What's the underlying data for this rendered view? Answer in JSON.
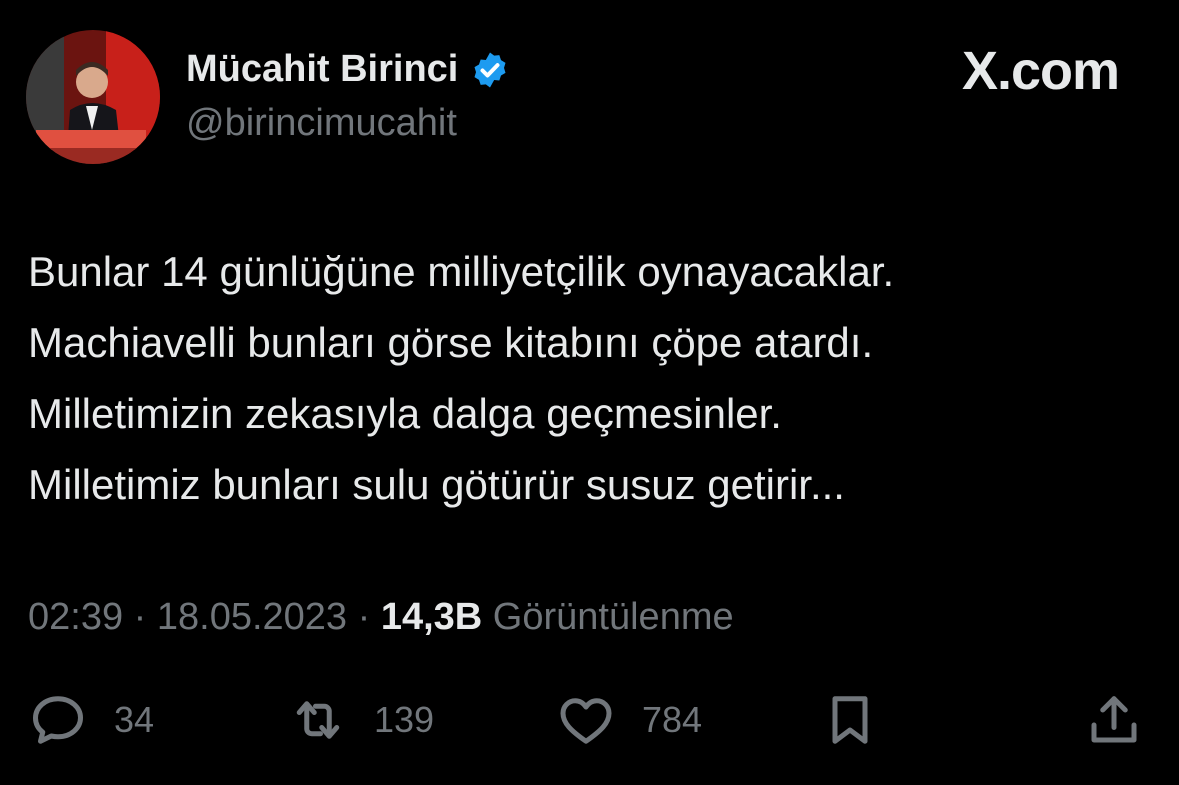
{
  "author": {
    "name": "Mücahit Birinci",
    "handle": "@birincimucahit",
    "verified": true,
    "avatar_icon": "avatar-photo"
  },
  "brand": "X.com",
  "tweet": {
    "lines": [
      "Bunlar 14 günlüğüne milliyetçilik oynayacaklar.",
      "Machiavelli bunları görse kitabını çöpe atardı.",
      "Milletimizin zekasıyla dalga geçmesinler.",
      "Milletimiz bunları sulu götürür susuz getirir..."
    ]
  },
  "meta": {
    "time": "02:39",
    "separator": " · ",
    "date": "18.05.2023",
    "views_count": "14,3B",
    "views_label": " Görüntülenme"
  },
  "actions": {
    "replies": {
      "icon": "reply-icon",
      "count": "34"
    },
    "reposts": {
      "icon": "repost-icon",
      "count": "139"
    },
    "likes": {
      "icon": "heart-icon",
      "count": "784"
    },
    "bookmark": {
      "icon": "bookmark-icon"
    },
    "share": {
      "icon": "share-icon"
    }
  },
  "colors": {
    "background": "#000000",
    "text_primary": "#e7e9ea",
    "text_secondary": "#71767b",
    "verified_blue": "#1d9bf0"
  }
}
